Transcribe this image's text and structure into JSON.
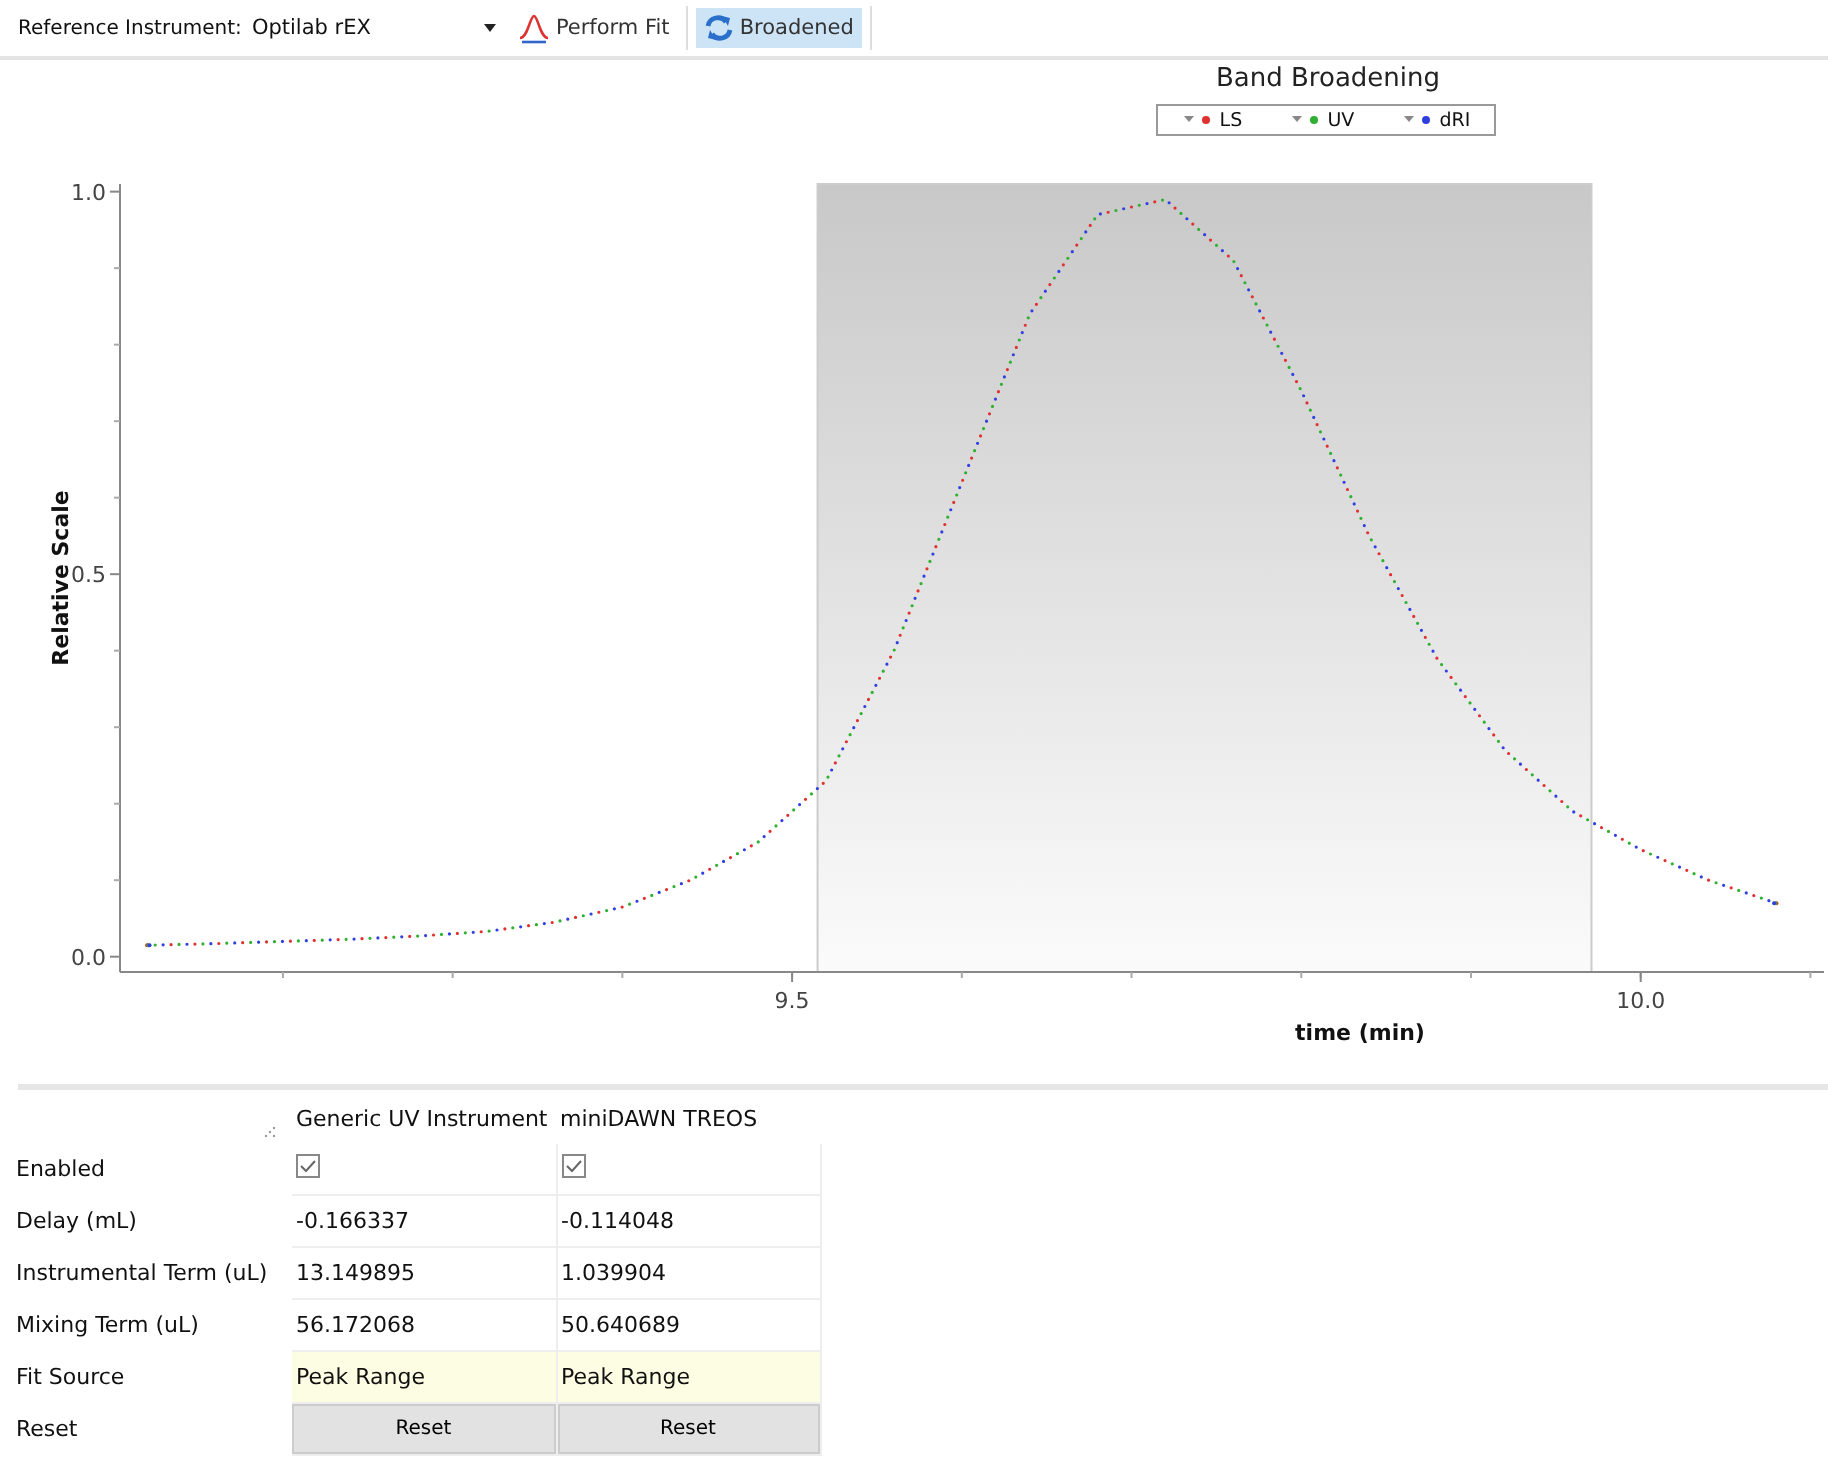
{
  "toolbar": {
    "reference_label": "Reference Instrument:",
    "reference_value": "Optilab rEX",
    "perform_fit": "Perform Fit",
    "broadened": {
      "label": "Broadened",
      "selected": true
    }
  },
  "chart": {
    "chart_data": {
      "type": "line",
      "title": "Band Broadening",
      "xlabel": "time (min)",
      "ylabel": "Relative Scale",
      "x": [
        9.12,
        9.16,
        9.2,
        9.24,
        9.28,
        9.32,
        9.36,
        9.4,
        9.44,
        9.48,
        9.52,
        9.56,
        9.6,
        9.64,
        9.68,
        9.72,
        9.76,
        9.8,
        9.84,
        9.88,
        9.92,
        9.96,
        10.0,
        10.04,
        10.08
      ],
      "series": [
        {
          "name": "LS",
          "color": "#e03030",
          "line_style": "dotted",
          "values": [
            0.015,
            0.017,
            0.02,
            0.023,
            0.027,
            0.033,
            0.045,
            0.065,
            0.1,
            0.15,
            0.23,
            0.4,
            0.62,
            0.84,
            0.97,
            0.99,
            0.91,
            0.74,
            0.55,
            0.39,
            0.27,
            0.19,
            0.14,
            0.1,
            0.07
          ]
        },
        {
          "name": "UV",
          "color": "#30b030",
          "line_style": "dotted",
          "values": [
            0.015,
            0.017,
            0.02,
            0.023,
            0.027,
            0.033,
            0.045,
            0.065,
            0.1,
            0.15,
            0.23,
            0.4,
            0.62,
            0.84,
            0.97,
            0.99,
            0.91,
            0.74,
            0.55,
            0.39,
            0.27,
            0.19,
            0.14,
            0.1,
            0.07
          ]
        },
        {
          "name": "dRI",
          "color": "#3040e0",
          "line_style": "dotted",
          "values": [
            0.015,
            0.017,
            0.02,
            0.023,
            0.027,
            0.033,
            0.045,
            0.065,
            0.1,
            0.15,
            0.23,
            0.4,
            0.62,
            0.84,
            0.97,
            0.99,
            0.91,
            0.74,
            0.55,
            0.39,
            0.27,
            0.19,
            0.14,
            0.1,
            0.07
          ]
        }
      ],
      "xlim": [
        9.104,
        10.108
      ],
      "ylim": [
        -0.02,
        1.01
      ],
      "xticks": [
        {
          "value": 9.5,
          "label": "9.5"
        },
        {
          "value": 10.0,
          "label": "10.0"
        }
      ],
      "yticks": [
        {
          "value": 0,
          "label": "0.0"
        },
        {
          "value": 0.5,
          "label": "0.5"
        },
        {
          "value": 1,
          "label": "1.0"
        }
      ],
      "legend": "top"
    }
  },
  "table": {
    "columns": [
      "Generic UV Instrument",
      "miniDAWN TREOS"
    ],
    "rows": [
      {
        "label": "Enabled",
        "kind": "checkbox",
        "cells": [
          {
            "checked": true
          },
          {
            "checked": true
          }
        ]
      },
      {
        "label": "Delay (mL)",
        "kind": "text",
        "cells": [
          {
            "value": "-0.166337"
          },
          {
            "value": "-0.114048"
          }
        ]
      },
      {
        "label": "Instrumental Term (uL)",
        "kind": "text",
        "cells": [
          {
            "value": "13.149895"
          },
          {
            "value": "1.039904"
          }
        ]
      },
      {
        "label": "Mixing Term (uL)",
        "kind": "text",
        "cells": [
          {
            "value": "56.172068"
          },
          {
            "value": "50.640689"
          }
        ]
      },
      {
        "label": "Fit Source",
        "kind": "choice",
        "cells": [
          {
            "value": "Peak Range"
          },
          {
            "value": "Peak Range"
          }
        ]
      },
      {
        "label": "Reset",
        "kind": "button",
        "cells": [
          {
            "value": "Reset"
          },
          {
            "value": "Reset"
          }
        ]
      }
    ]
  }
}
